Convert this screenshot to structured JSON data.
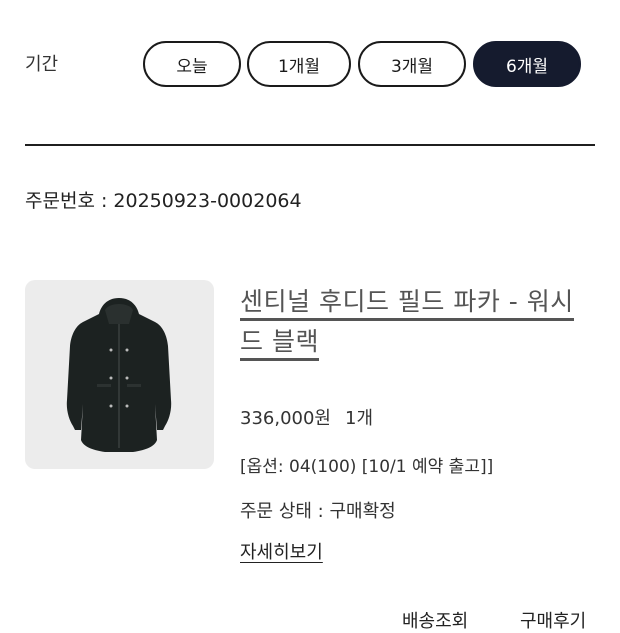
{
  "period": {
    "label": "기간",
    "options": [
      "오늘",
      "1개월",
      "3개월",
      "6개월"
    ],
    "selected": "6개월"
  },
  "order": {
    "number_text": "주문번호 : 20250923-0002064"
  },
  "product": {
    "name_line1": "센티널 후디드 필드 파카 - 워시",
    "name_line2": "드 블랙",
    "price": "336,000원",
    "quantity": "1개",
    "option": "[옵션: 04(100) [10/1 예약 출고]]",
    "status": "주문 상태 : 구매확정",
    "details_link": "자세히보기"
  },
  "actions": {
    "shipping": "배송조회",
    "review": "구매후기"
  }
}
